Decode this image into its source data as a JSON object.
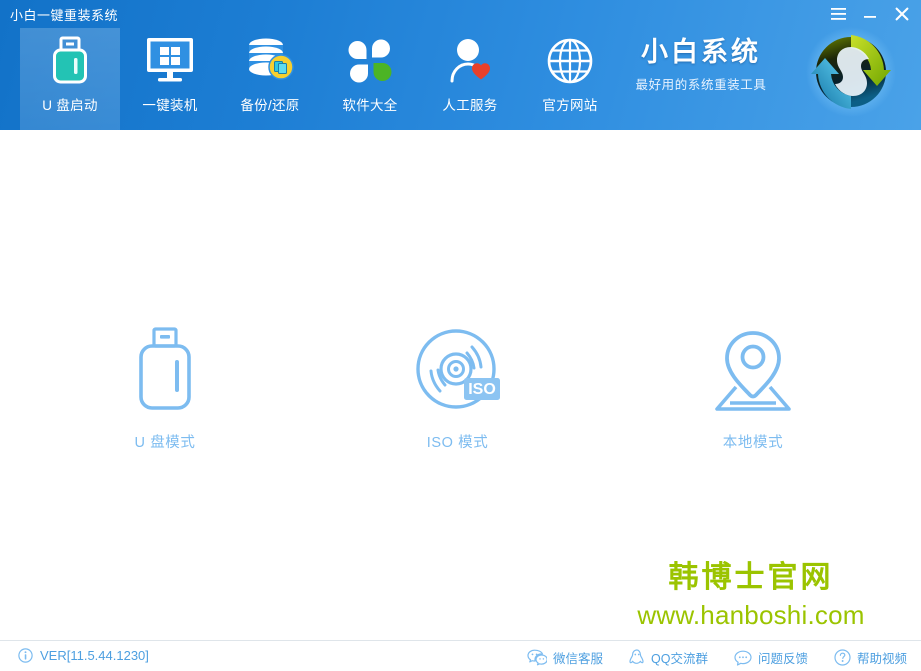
{
  "window": {
    "title": "小白一键重装系统",
    "controls": [
      {
        "name": "menu-button",
        "icon": "hamburger-icon",
        "label": "菜单"
      },
      {
        "name": "minimize-button",
        "icon": "minimize-icon",
        "label": "最小化"
      },
      {
        "name": "close-button",
        "icon": "close-icon",
        "label": "关闭"
      }
    ]
  },
  "nav": {
    "items": [
      {
        "id": "usb-boot",
        "label": "U 盘启动",
        "icon": "usb-drive-icon",
        "active": true
      },
      {
        "id": "one-key",
        "label": "一键装机",
        "icon": "monitor-windows-icon",
        "active": false
      },
      {
        "id": "backup",
        "label": "备份/还原",
        "icon": "database-restore-icon",
        "active": false
      },
      {
        "id": "software",
        "label": "软件大全",
        "icon": "clover-icon",
        "active": false
      },
      {
        "id": "support",
        "label": "人工服务",
        "icon": "person-heart-icon",
        "active": false
      },
      {
        "id": "website",
        "label": "官方网站",
        "icon": "globe-icon",
        "active": false
      }
    ]
  },
  "brand": {
    "name": "小白系统",
    "tagline": "最好用的系统重装工具",
    "logo_icon": "recycle-badge-logo"
  },
  "main": {
    "modes": [
      {
        "id": "usb-mode",
        "label": "U 盘模式",
        "icon": "usb-flash-outline-icon"
      },
      {
        "id": "iso-mode",
        "label": "ISO 模式",
        "icon": "disc-iso-icon",
        "badge": "ISO"
      },
      {
        "id": "local-mode",
        "label": "本地模式",
        "icon": "map-pin-icon"
      }
    ]
  },
  "watermark": {
    "cn": "韩博士官网",
    "url": "www.hanboshi.com"
  },
  "footer": {
    "version": "VER[11.5.44.1230]",
    "version_icon": "info-icon",
    "links": [
      {
        "id": "wechat",
        "label": "微信客服",
        "icon": "wechat-icon"
      },
      {
        "id": "qq-group",
        "label": "QQ交流群",
        "icon": "qq-penguin-icon"
      },
      {
        "id": "feedback",
        "label": "问题反馈",
        "icon": "chat-bubble-icon"
      },
      {
        "id": "help",
        "label": "帮助视频",
        "icon": "question-circle-icon"
      }
    ]
  },
  "colors": {
    "header_blue_dark": "#1272c8",
    "header_blue_light": "#4aa2e8",
    "accent_link": "#4d9fe0",
    "mode_icon_blue": "#7dbcf0",
    "watermark_green": "#9bc400",
    "badge_yellow": "#f5c518",
    "heart_red": "#e8402a",
    "clover_green": "#4caf29",
    "usb_teal": "#1ec8b6"
  }
}
